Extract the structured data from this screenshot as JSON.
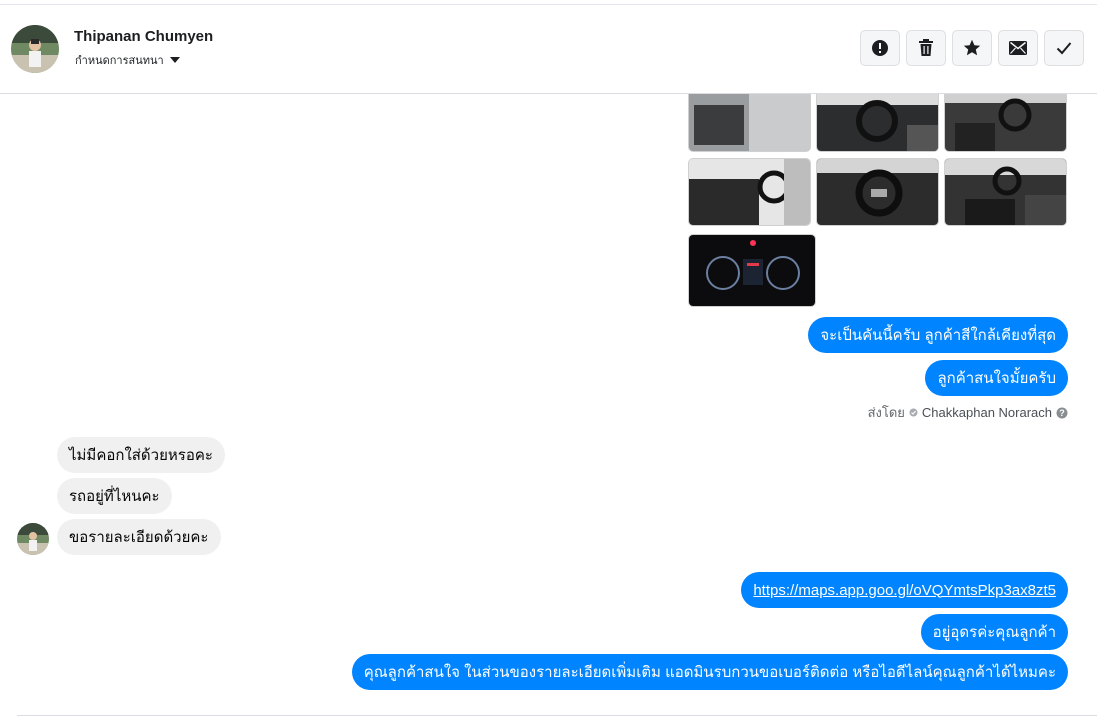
{
  "header": {
    "contact_name": "Thipanan Chumyen",
    "assign_label": "กำหนดการสนทนา",
    "actions": [
      {
        "name": "report-spam-button",
        "icon": "alert-circle-icon"
      },
      {
        "name": "delete-button",
        "icon": "trash-icon"
      },
      {
        "name": "star-button",
        "icon": "star-icon"
      },
      {
        "name": "mark-unread-button",
        "icon": "envelope-icon"
      },
      {
        "name": "mark-done-button",
        "icon": "check-icon"
      }
    ]
  },
  "messages": {
    "outgoing_1": "จะเป็นคันนี้ครับ ลูกค้าสีใกล้เคียงที่สุด",
    "outgoing_2": "ลูกค้าสนใจมั้ยครับ",
    "sent_by_prefix": "ส่งโดย",
    "sent_by_agent": "Chakkaphan Norarach",
    "incoming_1": "ไม่มีคอกใส่ด้วยหรอคะ",
    "incoming_2": "รถอยู่ที่ไหนคะ",
    "incoming_3": "ขอรายละเอียดด้วยคะ",
    "outgoing_link": "https://maps.app.goo.gl/oVQYmtsPkp3ax8zt5",
    "outgoing_3": "อยู่อุดรค่ะคุณลูกค้า",
    "outgoing_4": "คุณลูกค้าสนใจ ในส่วนของรายละเอียดเพิ่มเติม แอดมินรบกวนขอเบอร์ติดต่อ หรือไอดีไลน์คุณลูกค้าได้ไหมคะ"
  },
  "colors": {
    "outgoing_bubble": "#0084ff",
    "incoming_bubble": "#f0f0f0"
  }
}
